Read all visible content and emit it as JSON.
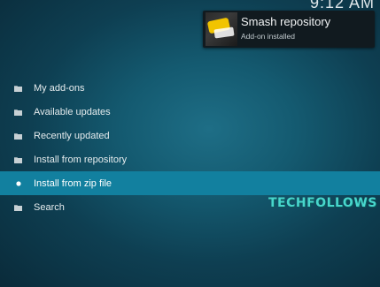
{
  "clock": {
    "time": "9:12 AM"
  },
  "notification": {
    "title": "Smash repository",
    "subtitle": "Add-on installed",
    "thumbnail_icon": "smash-repository-logo-icon"
  },
  "menu": {
    "items": [
      {
        "label": "My add-ons",
        "icon": "folder-icon"
      },
      {
        "label": "Available updates",
        "icon": "folder-icon"
      },
      {
        "label": "Recently updated",
        "icon": "folder-icon"
      },
      {
        "label": "Install from repository",
        "icon": "folder-icon"
      },
      {
        "label": "Install from zip file",
        "icon": "dot-icon",
        "selected": true
      },
      {
        "label": "Search",
        "icon": "folder-icon"
      }
    ]
  },
  "watermark": {
    "text": "TECHFOLLOWS"
  },
  "colors": {
    "selection": "#12809f",
    "background": "#145a70",
    "watermark": "#48d6cc"
  }
}
